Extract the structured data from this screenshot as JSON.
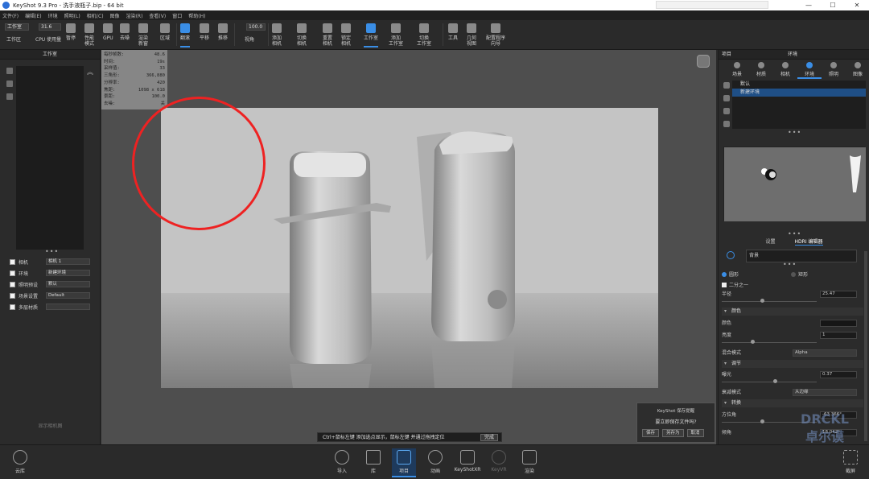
{
  "window": {
    "title": "KeyShot 9.3 Pro - 洗手液瓶子.bip - 64 bit",
    "min": "—",
    "max": "☐",
    "close": "✕"
  },
  "menu": [
    "文件(F)",
    "编辑(E)",
    "环境",
    "照明(L)",
    "相机(C)",
    "图像",
    "渲染(R)",
    "查看(V)",
    "窗口",
    "帮助(H)"
  ],
  "toolbar": {
    "workspace_dropdown": "工作室",
    "cpu_dropdown": "31.6",
    "zoom_value": "100.0",
    "items": [
      {
        "label": "工作区"
      },
      {
        "label": "CPU 使用量"
      },
      {
        "label": "暂停"
      },
      {
        "label": "性能\n模式"
      },
      {
        "label": "GPU"
      },
      {
        "label": "去噪"
      },
      {
        "label": "渲染\n新窗"
      },
      {
        "label": "区域"
      },
      {
        "label": "翻滚"
      },
      {
        "label": "平移"
      },
      {
        "label": "推移"
      },
      {
        "label": "视角"
      },
      {
        "label": "添加\n相机"
      },
      {
        "label": "切换\n相机"
      },
      {
        "label": "重置\n相机"
      },
      {
        "label": "锁定\n相机"
      },
      {
        "label": "工作室"
      },
      {
        "label": "添加\n工作室"
      },
      {
        "label": "切换\n工作室"
      },
      {
        "label": "工具"
      },
      {
        "label": "几何\n视图"
      },
      {
        "label": "配置程序\n向导"
      }
    ]
  },
  "left_panel": {
    "title": "工作室",
    "rows": [
      {
        "label": "相机",
        "value": "相机 1"
      },
      {
        "label": "环境",
        "value": "新建环境"
      },
      {
        "label": "照明预设",
        "value": "默认"
      },
      {
        "label": "场景设置",
        "value": "Default"
      },
      {
        "label": "多层材质",
        "value": ""
      }
    ],
    "empty_hint": "显示相机图"
  },
  "viewport": {
    "stats": [
      {
        "k": "每秒帧数:",
        "v": "48.6"
      },
      {
        "k": "时间:",
        "v": "19s"
      },
      {
        "k": "采样值:",
        "v": "33"
      },
      {
        "k": "三角形:",
        "v": "366,880"
      },
      {
        "k": "分辨率:",
        "v": "420"
      },
      {
        "k": "焦距:",
        "v": "1098 x 618"
      },
      {
        "k": "景距:",
        "v": "100.0"
      },
      {
        "k": "去噪:",
        "v": "关"
      }
    ],
    "hint_text": "Ctrl+鼠标左键 添加选点显示，鼠标左键 并通过拖拽定位",
    "hint_done": "完成"
  },
  "save_dialog": {
    "title": "KeyShot 保存提醒",
    "message": "要立即保存文件吗?",
    "save": "保存",
    "save_as": "另存为",
    "cancel": "取消"
  },
  "right_panel": {
    "title_left": "项目",
    "title_center": "环境",
    "tabs": [
      {
        "label": "场景"
      },
      {
        "label": "材质"
      },
      {
        "label": "相机"
      },
      {
        "label": "环境"
      },
      {
        "label": "照明"
      },
      {
        "label": "图像"
      }
    ],
    "env_items": [
      "默认",
      "新建环境"
    ],
    "subtabs": [
      "设置",
      "HDRI 编辑器"
    ],
    "background_label": "背景",
    "radio_round": "圆形",
    "radio_rect": "矩形",
    "half_label": "二分之一",
    "radius_label": "半径",
    "radius_value": "25.47",
    "color_section": "颜色",
    "color_label": "颜色",
    "brightness_label": "亮度",
    "brightness_value": "1",
    "blend_label": "混合模式",
    "blend_value": "Alpha",
    "adjust_section": "调节",
    "exposure_label": "曝光",
    "exposure_value": "0.37",
    "falloff_label": "衰减模式",
    "falloff_value": "从边缘",
    "transform_section": "转换",
    "azimuth_label": "方位角",
    "azimuth_value": "-63.366°",
    "tilt_label": "倾角",
    "tilt_value": "18.042°"
  },
  "watermark": [
    "DRCKL",
    "卓尔谟"
  ],
  "bottombar": {
    "cloud_label": "云库",
    "items": [
      {
        "label": "导入"
      },
      {
        "label": "库"
      },
      {
        "label": "项目"
      },
      {
        "label": "动画"
      },
      {
        "label": "KeyShotXR"
      },
      {
        "label": "KeyVR"
      },
      {
        "label": "渲染"
      }
    ],
    "screenshot_label": "截屏"
  }
}
